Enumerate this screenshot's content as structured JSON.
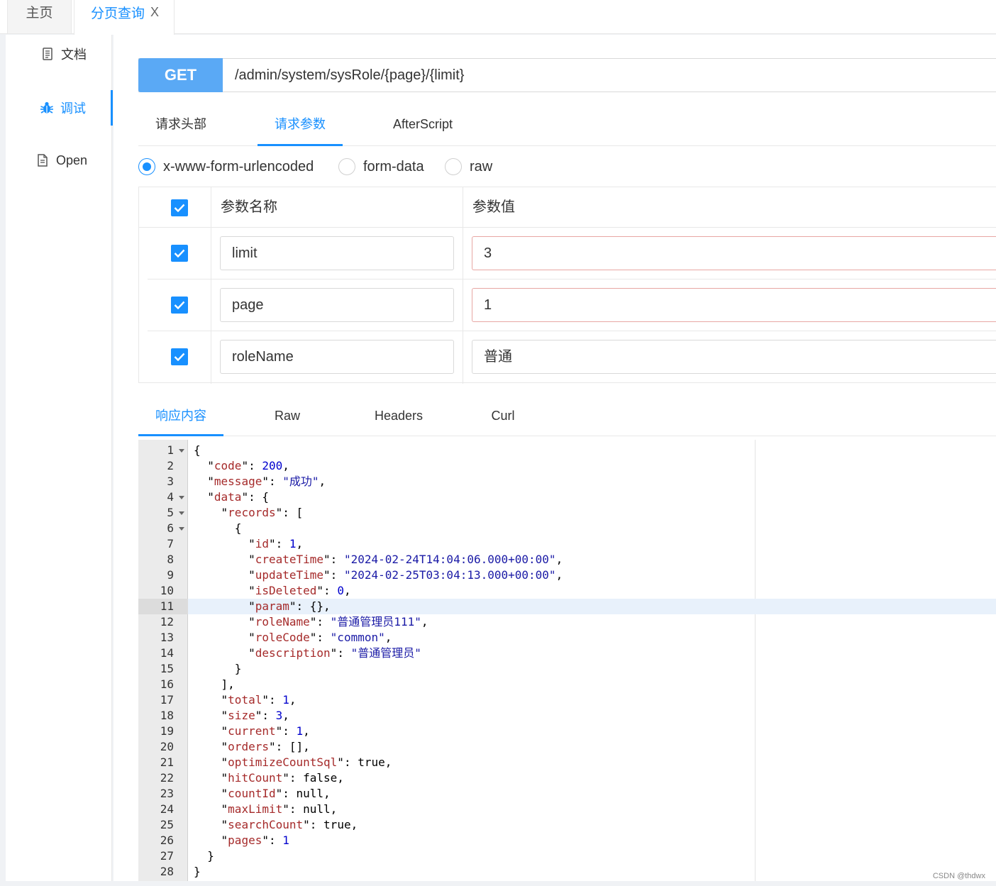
{
  "tabs": {
    "home_label": "主页",
    "active_label": "分页查询",
    "close_glyph": "X"
  },
  "nav": {
    "doc_label": "文档",
    "debug_label": "调试",
    "open_label": "Open"
  },
  "request": {
    "method": "GET",
    "url": "/admin/system/sysRole/{page}/{limit}",
    "tabs": [
      "请求头部",
      "请求参数",
      "AfterScript"
    ],
    "active_tab": "请求参数",
    "body_types": [
      "x-www-form-urlencoded",
      "form-data",
      "raw"
    ],
    "selected_body_type": "x-www-form-urlencoded"
  },
  "params": {
    "header_name": "参数名称",
    "header_value": "参数值",
    "rows": [
      {
        "name": "limit",
        "value": "3",
        "checked": true
      },
      {
        "name": "page",
        "value": "1",
        "checked": true
      },
      {
        "name": "roleName",
        "value": "普通",
        "checked": true
      }
    ]
  },
  "response": {
    "tabs": [
      "响应内容",
      "Raw",
      "Headers",
      "Curl"
    ],
    "active_tab": "响应内容",
    "highlighted_line": 11,
    "folded_lines": [
      1,
      4,
      5,
      6
    ],
    "lines": [
      "{",
      "  \"code\": 200,",
      "  \"message\": \"成功\",",
      "  \"data\": {",
      "    \"records\": [",
      "      {",
      "        \"id\": 1,",
      "        \"createTime\": \"2024-02-24T14:04:06.000+00:00\",",
      "        \"updateTime\": \"2024-02-25T03:04:13.000+00:00\",",
      "        \"isDeleted\": 0,",
      "        \"param\": {},",
      "        \"roleName\": \"普通管理员111\",",
      "        \"roleCode\": \"common\",",
      "        \"description\": \"普通管理员\"",
      "      }",
      "    ],",
      "    \"total\": 1,",
      "    \"size\": 3,",
      "    \"current\": 1,",
      "    \"orders\": [],",
      "    \"optimizeCountSql\": true,",
      "    \"hitCount\": false,",
      "    \"countId\": null,",
      "    \"maxLimit\": null,",
      "    \"searchCount\": true,",
      "    \"pages\": 1",
      "  }",
      "}"
    ]
  },
  "watermark": "CSDN @thdwx",
  "colors": {
    "accent": "#1890ff",
    "method_bg": "#5aa9f5",
    "json_key": "#a52a2a",
    "json_string": "#1a1aa6",
    "json_number": "#0000cd"
  }
}
